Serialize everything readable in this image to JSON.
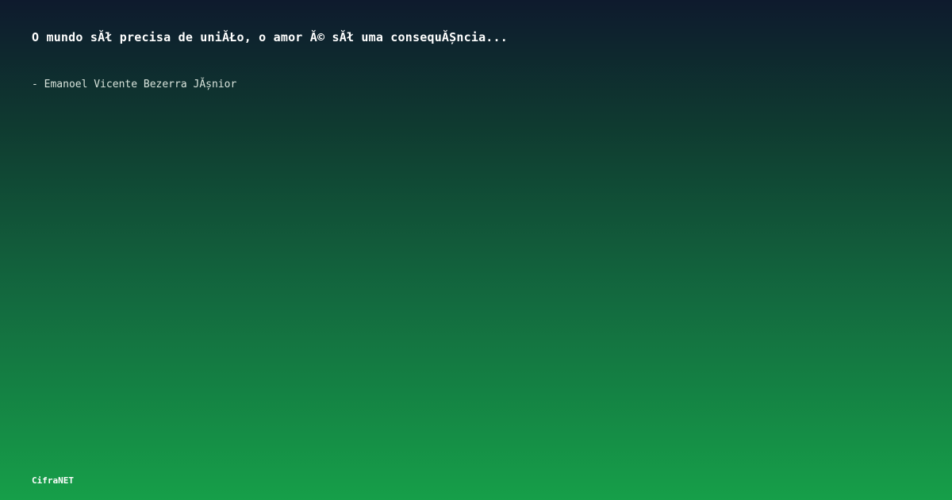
{
  "quote": {
    "text": "O mundo sĂł precisa de uniĂŁo, o amor Ă© sĂł uma consequĂȘncia..."
  },
  "author": {
    "text": "- Emanoel Vicente Bezerra JĂșnior"
  },
  "brand": {
    "text": "CifraNET"
  },
  "colors": {
    "background_top": "#0e1a2d",
    "background_bottom": "#169f49",
    "text": "#ffffff"
  }
}
